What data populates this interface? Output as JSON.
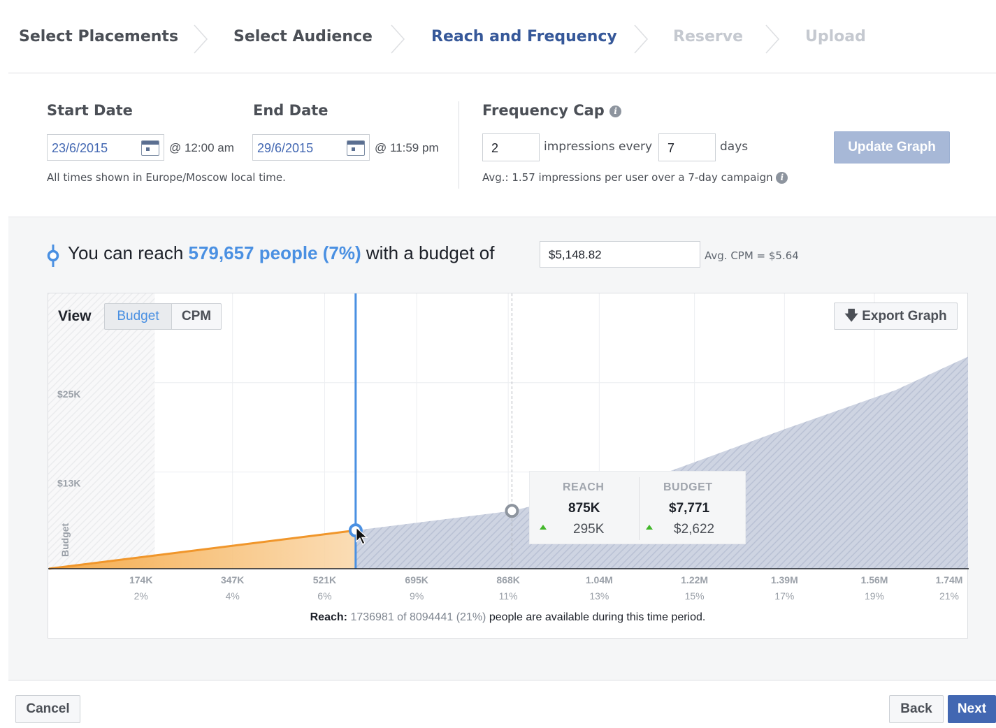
{
  "steps": [
    {
      "label": "Select Placements",
      "state": "done"
    },
    {
      "label": "Select Audience",
      "state": "done"
    },
    {
      "label": "Reach and Frequency",
      "state": "active"
    },
    {
      "label": "Reserve",
      "state": "future"
    },
    {
      "label": "Upload",
      "state": "future"
    }
  ],
  "schedule": {
    "start_label": "Start Date",
    "start_date": "23/6/2015",
    "start_time": "@ 12:00 am",
    "end_label": "End Date",
    "end_date": "29/6/2015",
    "end_time": "@ 11:59 pm",
    "timezone_note": "All times shown in Europe/Moscow local time."
  },
  "frequency": {
    "label": "Frequency Cap",
    "impressions": "2",
    "impressions_text": "impressions every",
    "days": "7",
    "days_text": "days",
    "avg_note": "Avg.: 1.57 impressions per user over a 7-day campaign",
    "update_button": "Update Graph"
  },
  "summary": {
    "prefix": "You can reach",
    "highlight": "579,657 people (7%)",
    "suffix": "with a budget of",
    "budget_value": "$5,148.82",
    "avg_cpm": "Avg. CPM = $5.64"
  },
  "chart_controls": {
    "view_label": "View",
    "tab_budget": "Budget",
    "tab_cpm": "CPM",
    "export_button": "Export Graph"
  },
  "tooltip": {
    "reach_header": "REACH",
    "reach_value": "875K",
    "reach_delta": "295K",
    "budget_header": "BUDGET",
    "budget_value": "$7,771",
    "budget_delta": "$2,622"
  },
  "chart_data": {
    "type": "area",
    "ylabel": "Budget",
    "y_ticks": [
      {
        "label": "$13K",
        "value": 13000
      },
      {
        "label": "$25K",
        "value": 25000
      }
    ],
    "ylim": [
      0,
      37000
    ],
    "xlim": [
      0,
      1736981
    ],
    "x_ticks": [
      {
        "value": 174000,
        "label": "174K",
        "pct": "2%"
      },
      {
        "value": 347000,
        "label": "347K",
        "pct": "4%"
      },
      {
        "value": 521000,
        "label": "521K",
        "pct": "6%"
      },
      {
        "value": 695000,
        "label": "695K",
        "pct": "9%"
      },
      {
        "value": 868000,
        "label": "868K",
        "pct": "11%"
      },
      {
        "value": 1040000,
        "label": "1.04M",
        "pct": "13%"
      },
      {
        "value": 1220000,
        "label": "1.22M",
        "pct": "15%"
      },
      {
        "value": 1390000,
        "label": "1.39M",
        "pct": "17%"
      },
      {
        "value": 1560000,
        "label": "1.56M",
        "pct": "19%"
      },
      {
        "value": 1740000,
        "label": "1.74M",
        "pct": "21%"
      }
    ],
    "curve": [
      {
        "x": 0,
        "y": 0
      },
      {
        "x": 579657,
        "y": 5149
      },
      {
        "x": 875000,
        "y": 7771
      },
      {
        "x": 1150000,
        "y": 12500
      },
      {
        "x": 1400000,
        "y": 19000
      },
      {
        "x": 1600000,
        "y": 24000
      },
      {
        "x": 1736981,
        "y": 28500
      }
    ],
    "selected": {
      "x": 579657,
      "y": 5149
    },
    "hover": {
      "x": 875000,
      "y": 7771
    },
    "unavailable_until": 200000,
    "colors": {
      "selected_fill": "#f5a742",
      "rest_fill": "#c7cede",
      "marker": "#4a90e2",
      "hover": "#8d949e"
    }
  },
  "reach_caption": {
    "label": "Reach:",
    "muted": "1736981 of 8094441 (21%)",
    "rest": "people are available during this time period."
  },
  "footer": {
    "cancel": "Cancel",
    "back": "Back",
    "next": "Next"
  }
}
